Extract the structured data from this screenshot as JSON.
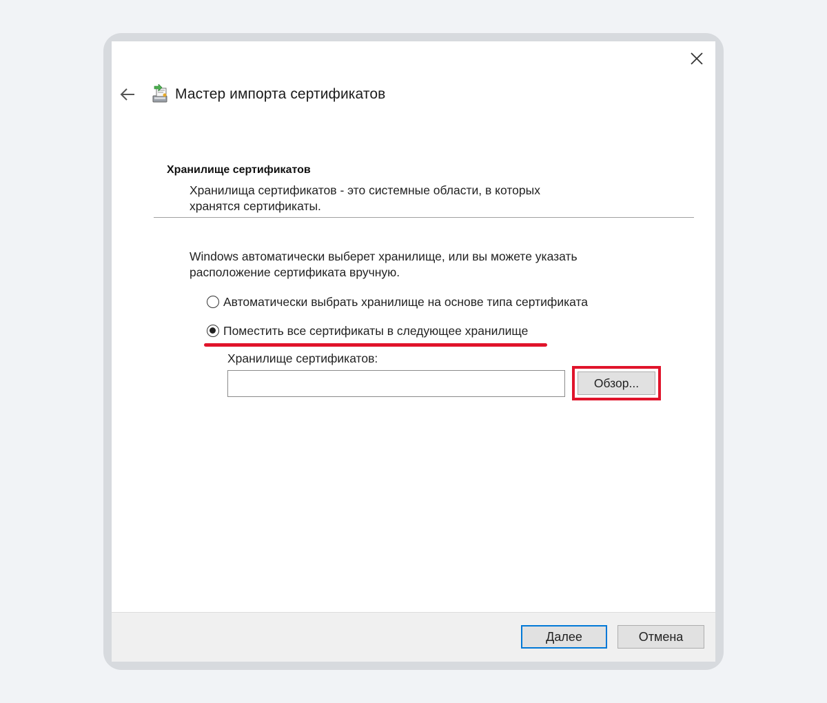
{
  "wizard": {
    "title": "Мастер импорта сертификатов"
  },
  "section": {
    "title": "Хранилище сертификатов",
    "description": "Хранилища сертификатов - это системные области, в которых хранятся сертификаты."
  },
  "intro": "Windows автоматически выберет хранилище, или вы можете указать расположение сертификата вручную.",
  "options": [
    {
      "label": "Автоматически выбрать хранилище на основе типа сертификата",
      "selected": false
    },
    {
      "label": "Поместить все сертификаты в следующее хранилище",
      "selected": true
    }
  ],
  "store": {
    "label": "Хранилище сертификатов:",
    "value": "",
    "browse_label": "Обзор..."
  },
  "footer": {
    "next_label": "Далее",
    "cancel_label": "Отмена"
  },
  "icons": {
    "close": "close-icon",
    "back": "back-arrow-icon",
    "wizard": "certificate-wizard-icon"
  },
  "colors": {
    "highlight": "#e0142b",
    "default_button_border": "#0078d7"
  }
}
